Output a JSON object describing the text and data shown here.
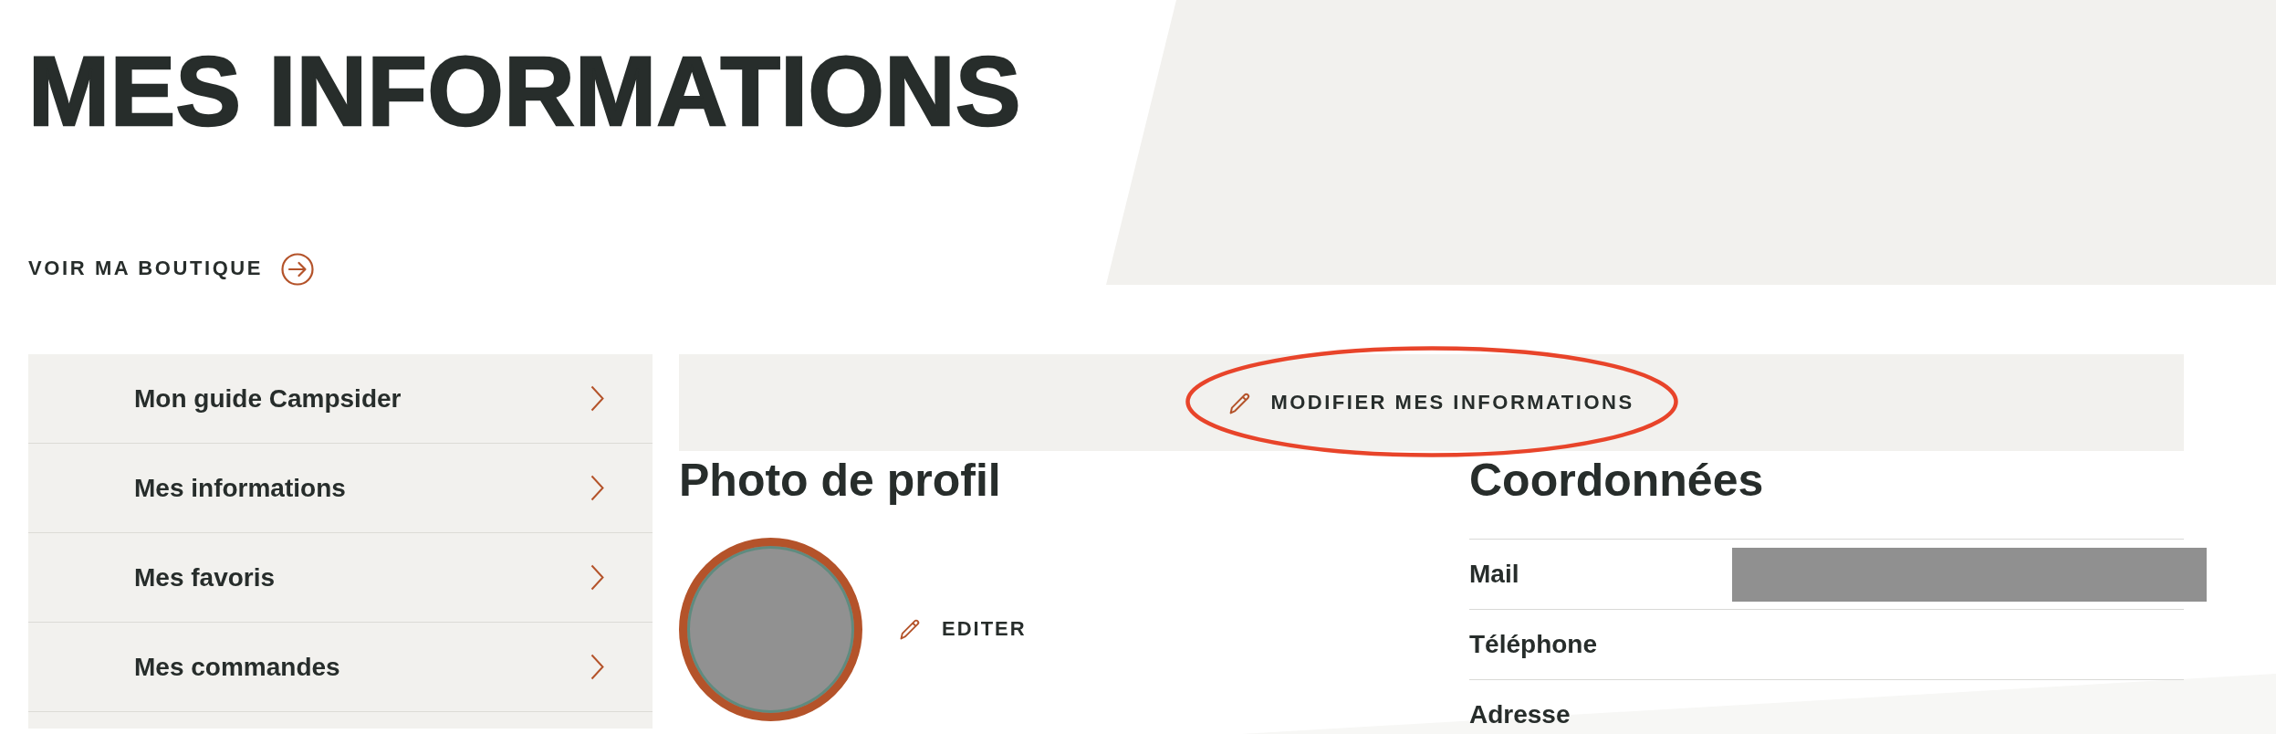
{
  "page_title": "MES INFORMATIONS",
  "shop_link": {
    "label": "VOIR MA BOUTIQUE"
  },
  "sidebar": {
    "items": [
      {
        "label": "Mon guide Campsider"
      },
      {
        "label": "Mes informations"
      },
      {
        "label": "Mes favoris"
      },
      {
        "label": "Mes commandes"
      }
    ]
  },
  "edit_banner": {
    "label": "MODIFIER MES INFORMATIONS",
    "highlighted": true
  },
  "profile_photo": {
    "heading": "Photo de profil",
    "edit_label": "EDITER"
  },
  "contact": {
    "heading": "Coordonnées",
    "fields": [
      {
        "label": "Mail",
        "redacted": true
      },
      {
        "label": "Téléphone",
        "redacted": false
      },
      {
        "label": "Adresse",
        "redacted": false
      }
    ]
  }
}
